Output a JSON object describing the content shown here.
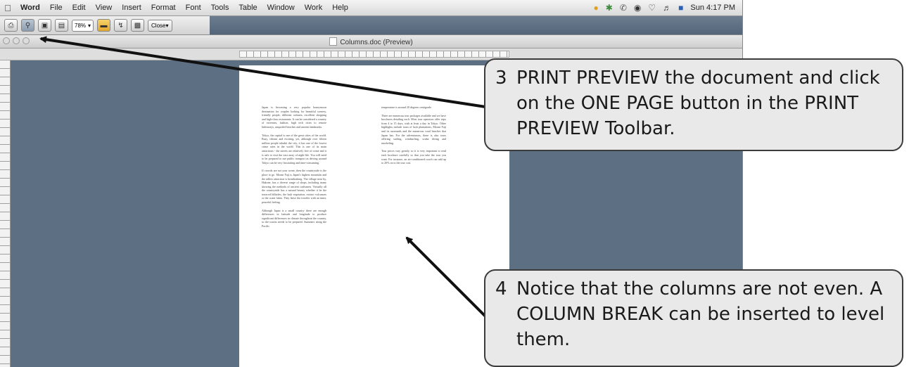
{
  "menubar": {
    "app": "Word",
    "items": [
      "File",
      "Edit",
      "View",
      "Insert",
      "Format",
      "Font",
      "Tools",
      "Table",
      "Window",
      "Work",
      "Help"
    ],
    "clock": "Sun 4:17 PM"
  },
  "toolbar": {
    "zoom": "78%",
    "close_label": "Close"
  },
  "window": {
    "title": "Columns.doc (Preview)"
  },
  "callouts": {
    "step3": {
      "number": "3",
      "text": "PRINT PREVIEW the document and click on the ONE PAGE button in the PRINT PREVIEW Toolbar."
    },
    "step4": {
      "number": "4",
      "text": "Notice that the columns are not even. A COLUMN BREAK can be inserted to level them."
    }
  },
  "document": {
    "column1": [
      "Japan is becoming a very popular honeymoon destination for couples looking for beautiful scenery, friendly people, different cultures, excellent shopping and high-class restaurants. It can be considered a country of extremes, fashion, high tech cities to remote hideaways, unspoiled beaches and ancient landmarks.",
      "Tokyo, the capital is one of the great cities of the world. Busy, vibrant and exciting, yet, although over fifteen million people inhabit the city, it has one of the lowest crime rates in the world. This is one of its main attractions - the streets are relatively free of crime and it is safe to visit the vast array of night-life. You will need to be prepared to use public transport as driving around Tokyo can be very frustrating and time-consuming.",
      "If crowds are not your scene, then the countryside is the place to go. Mount Fuji is Japan's highest mountain and the tallest attraction is breathtaking. The village near by, Hakone, has a diverse range of shops, including many showing the methods of ancient craftsmen. Virtually all the countryside has a natural beauty whether it be the terraced hillsides, the lush vegetation, extinct volcanoes or the crater lakes. They leave the traveler with an inner, peaceful feeling.",
      "Although Japan is a small country there are enough differences in latitude and longitude to produce significant differences in climate throughout the country, so the tourist needs to be prepared. Summers along the Pacific"
    ],
    "column2": [
      "temperature is around 20 degrees centigrade.",
      "There are numerous tour packages available and we have brochures detailing each. Most tour operators offer trips from 4 to 15 days, with at least a day in Tokyo. Other highlights include tours of lush plantations, Mount Fuji and its surrounds and the numerous coral beaches that Japan has. For the adventurous, there is also tours offering surfing, windsurfing, scuba diving and snorkeling.",
      "Tour prices vary greatly, so it is very important to read each brochure carefully so that you take the tour you want. For instance, an air-conditioned coach can add up to 20% on to the tour cost."
    ]
  }
}
